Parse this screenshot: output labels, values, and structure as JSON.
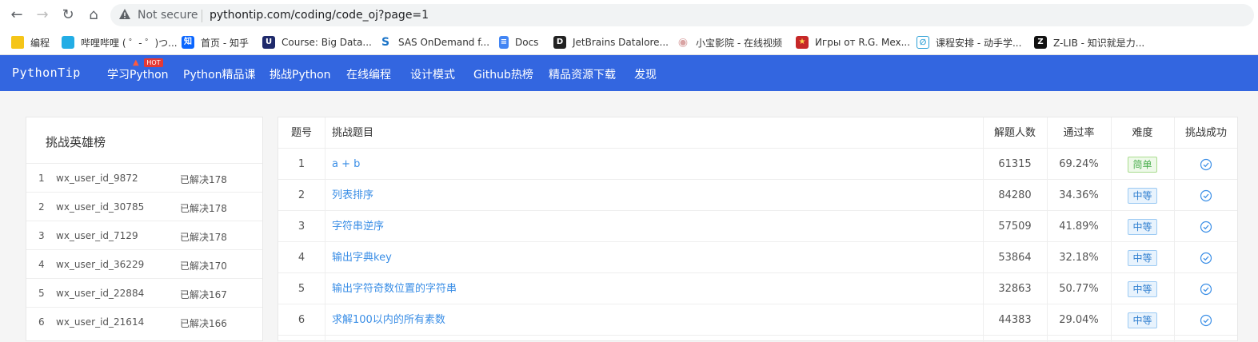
{
  "browser": {
    "security_label": "Not secure",
    "url": "pythontip.com/coding/code_oj?page=1",
    "bookmarks": [
      {
        "label": "编程",
        "color": "#f5c518",
        "glyph": ""
      },
      {
        "label": "哔哩哔哩 ( ゜- ゜)つ...",
        "color": "#23ade5",
        "glyph": "b"
      },
      {
        "label": "首页 - 知乎",
        "color": "#0a66ff",
        "glyph": "知"
      },
      {
        "label": "Course: Big Data...",
        "color": "#1f2a6b",
        "glyph": "U"
      },
      {
        "label": "SAS OnDemand f...",
        "color": "#1a73c7",
        "glyph": "S"
      },
      {
        "label": "Docs",
        "color": "#4285f4",
        "glyph": "≡"
      },
      {
        "label": "JetBrains Datalore...",
        "color": "#222222",
        "glyph": "D"
      },
      {
        "label": "小宝影院 - 在线视频",
        "color": "#e9b7b7",
        "glyph": "·"
      },
      {
        "label": "Игры от R.G. Mex...",
        "color": "#c62828",
        "glyph": "★"
      },
      {
        "label": "课程安排 - 动手学...",
        "color": "#2a9fd6",
        "glyph": "∅"
      },
      {
        "label": "Z-LIB - 知识就是力...",
        "color": "#111111",
        "glyph": "Z"
      }
    ]
  },
  "site": {
    "brand": "PythonTip",
    "hot_badge": "HOT",
    "nav": [
      "学习Python",
      "Python精品课",
      "挑战Python",
      "在线编程",
      "设计模式",
      "Github热榜",
      "精品资源下载",
      "发现"
    ]
  },
  "leaderboard": {
    "title": "挑战英雄榜",
    "rows": [
      {
        "rank": "1",
        "user": "wx_user_id_9872",
        "solved": "已解决178"
      },
      {
        "rank": "2",
        "user": "wx_user_id_30785",
        "solved": "已解决178"
      },
      {
        "rank": "3",
        "user": "wx_user_id_7129",
        "solved": "已解决178"
      },
      {
        "rank": "4",
        "user": "wx_user_id_36229",
        "solved": "已解决170"
      },
      {
        "rank": "5",
        "user": "wx_user_id_22884",
        "solved": "已解决167"
      },
      {
        "rank": "6",
        "user": "wx_user_id_21614",
        "solved": "已解决166"
      }
    ]
  },
  "problems": {
    "headers": {
      "no": "题号",
      "title": "挑战题目",
      "solvers": "解题人数",
      "pass_rate": "通过率",
      "difficulty": "难度",
      "success": "挑战成功"
    },
    "rows": [
      {
        "no": "1",
        "title": "a + b",
        "solvers": "61315",
        "pass_rate": "69.24%",
        "difficulty": "简单",
        "level": "easy"
      },
      {
        "no": "2",
        "title": "列表排序",
        "solvers": "84280",
        "pass_rate": "34.36%",
        "difficulty": "中等",
        "level": "mid"
      },
      {
        "no": "3",
        "title": "字符串逆序",
        "solvers": "57509",
        "pass_rate": "41.89%",
        "difficulty": "中等",
        "level": "mid"
      },
      {
        "no": "4",
        "title": "输出字典key",
        "solvers": "53864",
        "pass_rate": "32.18%",
        "difficulty": "中等",
        "level": "mid"
      },
      {
        "no": "5",
        "title": "输出字符奇数位置的字符串",
        "solvers": "32863",
        "pass_rate": "50.77%",
        "difficulty": "中等",
        "level": "mid"
      },
      {
        "no": "6",
        "title": "求解100以内的所有素数",
        "solvers": "44383",
        "pass_rate": "29.04%",
        "difficulty": "中等",
        "level": "mid"
      }
    ]
  },
  "colors": {
    "nav_bg": "#3366e0",
    "link": "#3a8ee6",
    "easy": "#4caf50",
    "mid": "#2f7fd0"
  }
}
